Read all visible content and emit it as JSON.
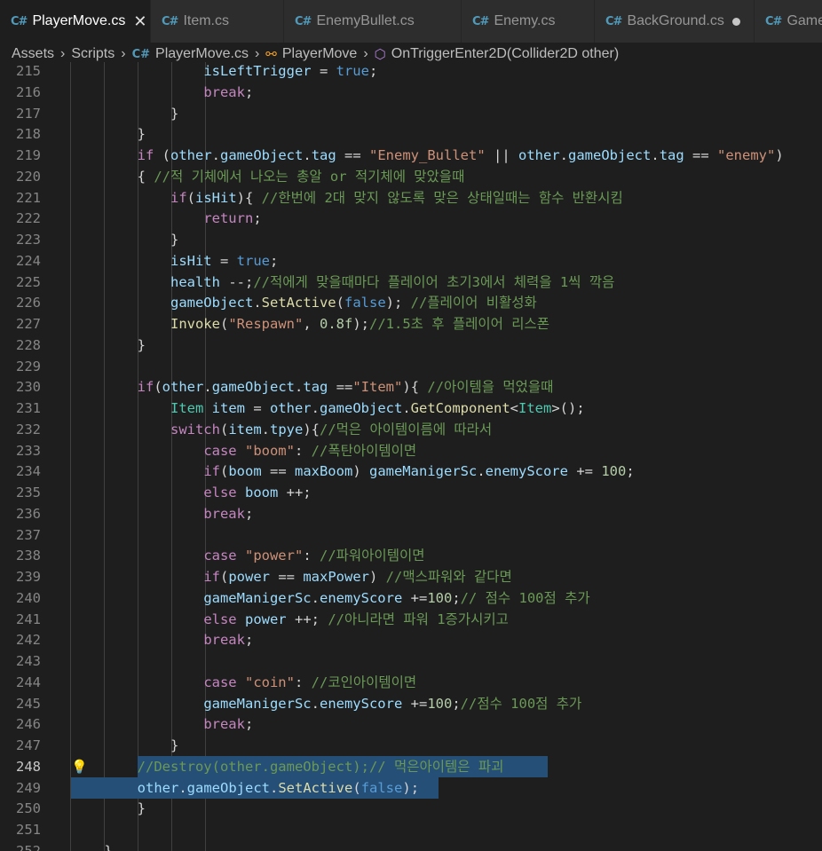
{
  "tabs": [
    {
      "label": "PlayerMove.cs",
      "active": true,
      "state": "close"
    },
    {
      "label": "Item.cs",
      "active": false,
      "state": ""
    },
    {
      "label": "EnemyBullet.cs",
      "active": false,
      "state": ""
    },
    {
      "label": "Enemy.cs",
      "active": false,
      "state": ""
    },
    {
      "label": "BackGround.cs",
      "active": false,
      "state": "dirty"
    },
    {
      "label": "GameM",
      "active": false,
      "state": ""
    }
  ],
  "icons": {
    "tab_file": "csharp-file-icon",
    "close": "close-icon",
    "dirty": "unsaved-dot-icon",
    "lightbulb": "lightbulb-icon"
  },
  "breadcrumb": {
    "items": [
      "Assets",
      "Scripts",
      "PlayerMove.cs",
      "PlayerMove",
      "OnTriggerEnter2D(Collider2D other)"
    ]
  },
  "editor": {
    "current_line": 248,
    "lines": [
      {
        "n": 215,
        "code": "                isLeftTrigger = true;"
      },
      {
        "n": 216,
        "code": "                break;"
      },
      {
        "n": 217,
        "code": "            }"
      },
      {
        "n": 218,
        "code": "        }"
      },
      {
        "n": 219,
        "code": "        if (other.gameObject.tag == \"Enemy_Bullet\" || other.gameObject.tag == \"enemy\")"
      },
      {
        "n": 220,
        "code": "        { //적 기체에서 나오는 총알 or 적기체에 맞았을때"
      },
      {
        "n": 221,
        "code": "            if(isHit){ //한번에 2대 맞지 않도록 맞은 상태일때는 함수 반환시킴"
      },
      {
        "n": 222,
        "code": "                return;"
      },
      {
        "n": 223,
        "code": "            }"
      },
      {
        "n": 224,
        "code": "            isHit = true;"
      },
      {
        "n": 225,
        "code": "            health --;//적에게 맞을때마다 플레이어 초기3에서 체력을 1씩 깍음"
      },
      {
        "n": 226,
        "code": "            gameObject.SetActive(false); //플레이어 비활성화"
      },
      {
        "n": 227,
        "code": "            Invoke(\"Respawn\", 0.8f);//1.5초 후 플레이어 리스폰"
      },
      {
        "n": 228,
        "code": "        }"
      },
      {
        "n": 229,
        "code": ""
      },
      {
        "n": 230,
        "code": "        if(other.gameObject.tag ==\"Item\"){ //아이템을 먹었을때"
      },
      {
        "n": 231,
        "code": "            Item item = other.gameObject.GetComponent<Item>();"
      },
      {
        "n": 232,
        "code": "            switch(item.tpye){//먹은 아이템이름에 따라서"
      },
      {
        "n": 233,
        "code": "                case \"boom\": //폭탄아이템이면"
      },
      {
        "n": 234,
        "code": "                if(boom == maxBoom) gameManigerSc.enemyScore += 100;"
      },
      {
        "n": 235,
        "code": "                else boom ++;"
      },
      {
        "n": 236,
        "code": "                break;"
      },
      {
        "n": 237,
        "code": ""
      },
      {
        "n": 238,
        "code": "                case \"power\": //파워아이템이면"
      },
      {
        "n": 239,
        "code": "                if(power == maxPower) //맥스파워와 같다면"
      },
      {
        "n": 240,
        "code": "                gameManigerSc.enemyScore +=100;// 점수 100점 추가"
      },
      {
        "n": 241,
        "code": "                else power ++; //아니라면 파워 1증가시키고"
      },
      {
        "n": 242,
        "code": "                break;"
      },
      {
        "n": 243,
        "code": ""
      },
      {
        "n": 244,
        "code": "                case \"coin\": //코인아이템이면"
      },
      {
        "n": 245,
        "code": "                gameManigerSc.enemyScore +=100;//점수 100점 추가"
      },
      {
        "n": 246,
        "code": "                break;"
      },
      {
        "n": 247,
        "code": "            }"
      },
      {
        "n": 248,
        "code": "        //Destroy(other.gameObject);// 먹은아이템은 파괴"
      },
      {
        "n": 249,
        "code": "        other.gameObject.SetActive(false);"
      },
      {
        "n": 250,
        "code": "        }"
      },
      {
        "n": 251,
        "code": ""
      },
      {
        "n": 252,
        "code": "    }"
      }
    ]
  }
}
